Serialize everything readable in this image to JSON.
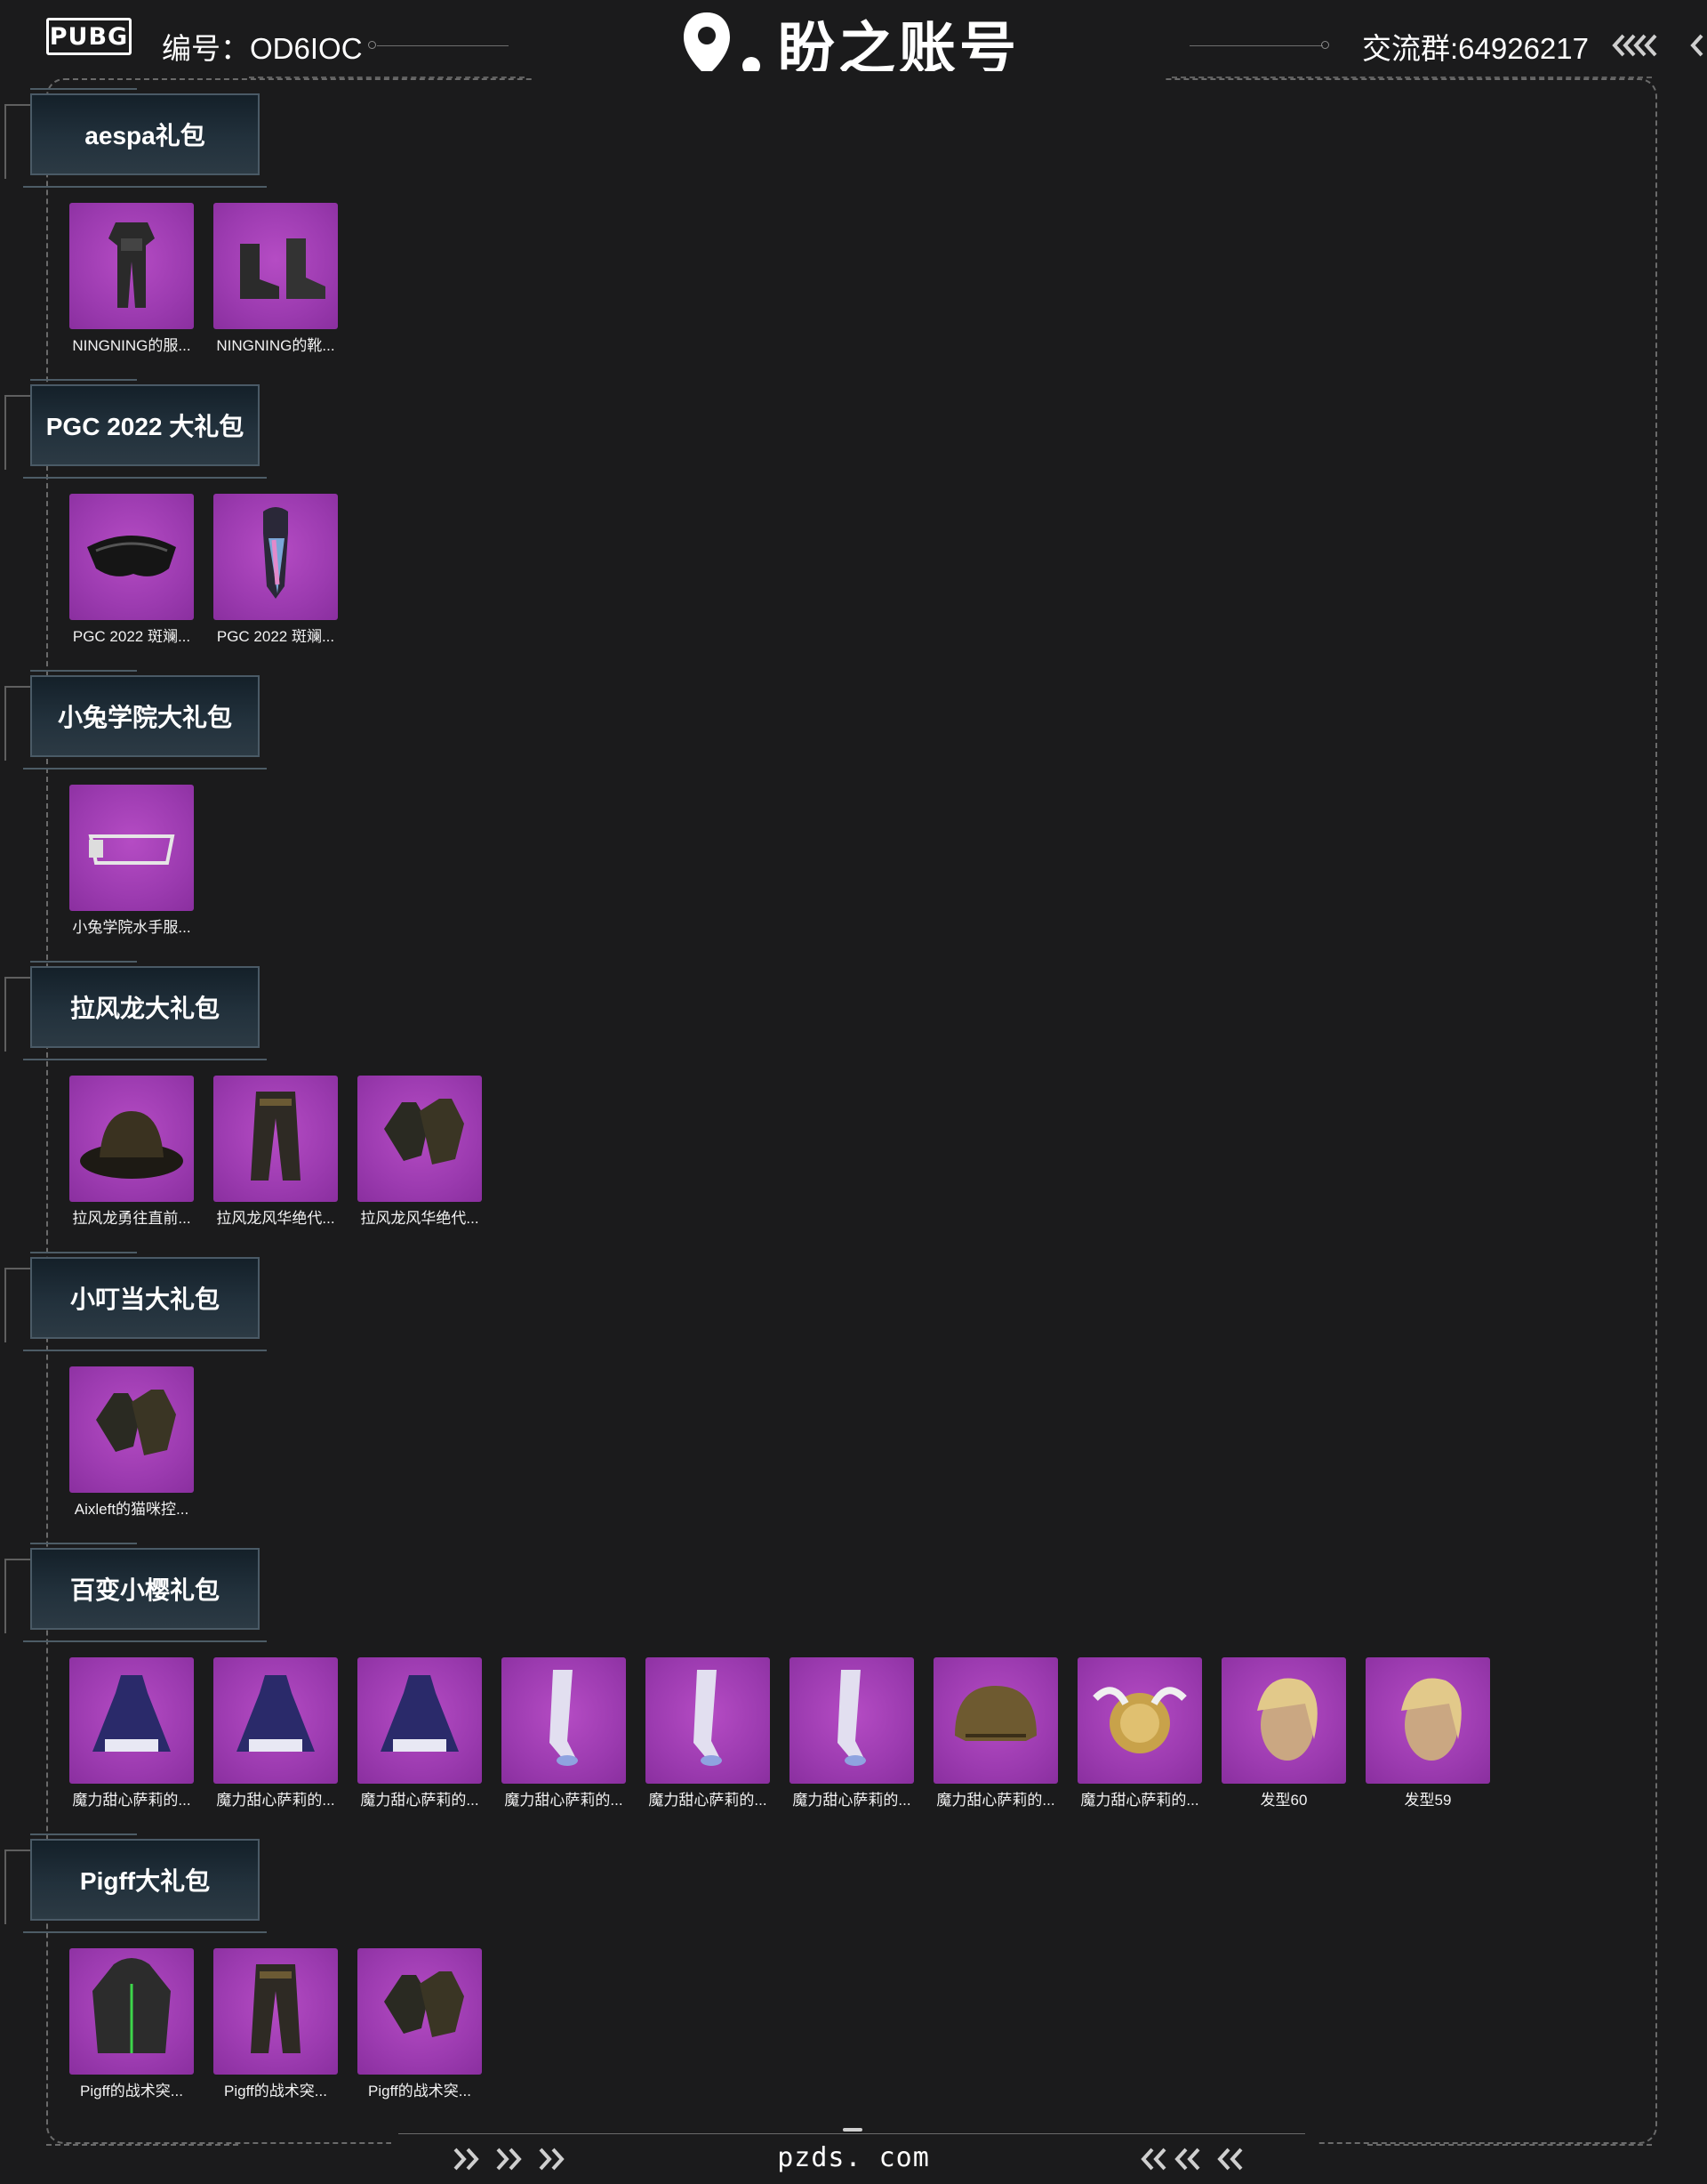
{
  "header": {
    "logo_text": "PUBG",
    "serial_label": "编号",
    "serial_value": "OD6IOC",
    "brand_name": "盼之账号",
    "group_label": "交流群",
    "group_value": "64926217"
  },
  "sections": [
    {
      "title": "aespa礼包",
      "items": [
        {
          "label": "NINGNING的服...",
          "icon": "outfit-icon"
        },
        {
          "label": "NINGNING的靴...",
          "icon": "boots-icon"
        }
      ]
    },
    {
      "title": "PGC 2022 大礼包",
      "items": [
        {
          "label": "PGC 2022 斑斓...",
          "icon": "goggles-icon"
        },
        {
          "label": "PGC 2022 斑斓...",
          "icon": "scarf-icon"
        }
      ]
    },
    {
      "title": "小兔学院大礼包",
      "items": [
        {
          "label": "小兔学院水手服...",
          "icon": "glasses-icon"
        }
      ]
    },
    {
      "title": "拉风龙大礼包",
      "items": [
        {
          "label": "拉风龙勇往直前...",
          "icon": "hat-icon"
        },
        {
          "label": "拉风龙风华绝代...",
          "icon": "pants-icon"
        },
        {
          "label": "拉风龙风华绝代...",
          "icon": "gloves-icon"
        }
      ]
    },
    {
      "title": "小叮当大礼包",
      "items": [
        {
          "label": "Aixleft的猫咪控...",
          "icon": "gloves-icon"
        }
      ]
    },
    {
      "title": "百变小樱礼包",
      "items": [
        {
          "label": "魔力甜心萨莉的...",
          "icon": "dress-icon"
        },
        {
          "label": "魔力甜心萨莉的...",
          "icon": "dress-icon"
        },
        {
          "label": "魔力甜心萨莉的...",
          "icon": "dress-icon"
        },
        {
          "label": "魔力甜心萨莉的...",
          "icon": "stocking-icon"
        },
        {
          "label": "魔力甜心萨莉的...",
          "icon": "stocking-icon"
        },
        {
          "label": "魔力甜心萨莉的...",
          "icon": "stocking-icon"
        },
        {
          "label": "魔力甜心萨莉的...",
          "icon": "helmet-icon"
        },
        {
          "label": "魔力甜心萨莉的...",
          "icon": "backpack-icon"
        },
        {
          "label": "发型60",
          "icon": "hairstyle-icon"
        },
        {
          "label": "发型59",
          "icon": "hairstyle-icon"
        }
      ]
    },
    {
      "title": "Pigff大礼包",
      "items": [
        {
          "label": "Pigff的战术突...",
          "icon": "jacket-icon"
        },
        {
          "label": "Pigff的战术突...",
          "icon": "pants-icon"
        },
        {
          "label": "Pigff的战术突...",
          "icon": "gloves-icon"
        }
      ]
    }
  ],
  "footer": {
    "url": "pzds. com"
  },
  "colors": {
    "background": "#1b1b1c",
    "item_bg": "#9c3bb0",
    "plate_bg": "#22313c"
  }
}
